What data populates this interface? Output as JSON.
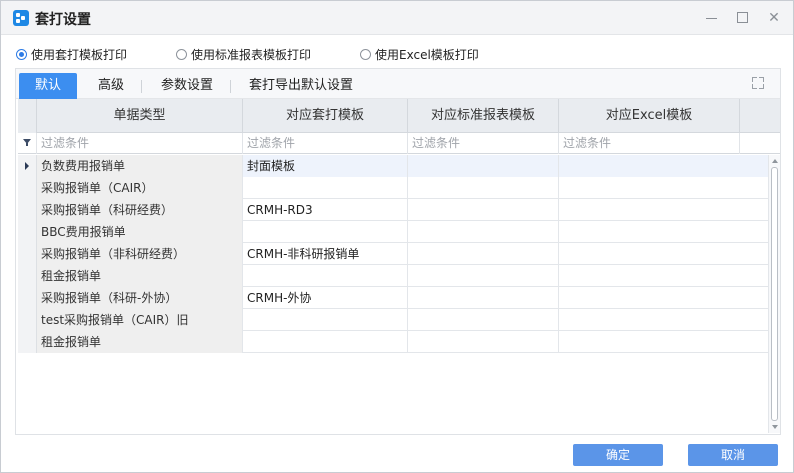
{
  "window": {
    "title": "套打设置"
  },
  "print_mode": {
    "options": [
      {
        "label": "使用套打模板打印",
        "selected": true
      },
      {
        "label": "使用标准报表模板打印",
        "selected": false
      },
      {
        "label": "使用Excel模板打印",
        "selected": false
      }
    ]
  },
  "tabs": [
    {
      "label": "默认",
      "active": true
    },
    {
      "label": "高级",
      "active": false
    },
    {
      "label": "参数设置",
      "active": false
    },
    {
      "label": "套打导出默认设置",
      "active": false
    }
  ],
  "grid": {
    "columns": [
      "单据类型",
      "对应套打模板",
      "对应标准报表模板",
      "对应Excel模板"
    ],
    "filter_placeholder": "过滤条件",
    "rows": [
      {
        "type": "负数费用报销单",
        "template": "封面模板",
        "std": "",
        "excel": "",
        "current": true
      },
      {
        "type": "采购报销单（CAIR）",
        "template": "",
        "std": "",
        "excel": ""
      },
      {
        "type": "采购报销单（科研经费）",
        "template": "CRMH-RD3",
        "std": "",
        "excel": ""
      },
      {
        "type": "BBC费用报销单",
        "template": "",
        "std": "",
        "excel": ""
      },
      {
        "type": "采购报销单（非科研经费）",
        "template": "CRMH-非科研报销单",
        "std": "",
        "excel": ""
      },
      {
        "type": "租金报销单",
        "template": "",
        "std": "",
        "excel": ""
      },
      {
        "type": "采购报销单（科研-外协）",
        "template": "CRMH-外协",
        "std": "",
        "excel": ""
      },
      {
        "type": "test采购报销单（CAIR）旧",
        "template": "",
        "std": "",
        "excel": ""
      },
      {
        "type": "租金报销单",
        "template": "",
        "std": "",
        "excel": ""
      }
    ]
  },
  "footer": {
    "ok_label": "确定",
    "cancel_label": "取消"
  },
  "colors": {
    "accent": "#3c8ef0",
    "button": "#5b95e8",
    "header_bg": "#e9ecf0"
  }
}
